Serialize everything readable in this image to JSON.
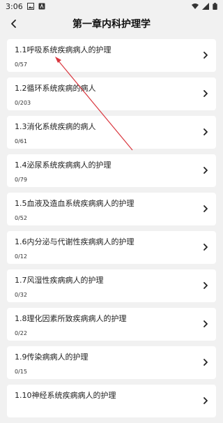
{
  "status": {
    "time": "3:06"
  },
  "header": {
    "title": "第一章内科护理学"
  },
  "chapters": [
    {
      "title": "1.1呼吸系统疾病病人的护理",
      "progress": "0/57"
    },
    {
      "title": "1.2循环系统疾病的病人",
      "progress": "0/203"
    },
    {
      "title": "1.3消化系统疾病的病人",
      "progress": "0/61"
    },
    {
      "title": "1.4泌尿系统疾病病人的护理",
      "progress": "0/79"
    },
    {
      "title": "1.5血液及造血系统疾病病人的护理",
      "progress": "0/52"
    },
    {
      "title": "1.6内分泌与代谢性疾病病人的护理",
      "progress": "0/12"
    },
    {
      "title": "1.7风湿性疾病病人的护理",
      "progress": "0/32"
    },
    {
      "title": "1.8理化因素所致疾病病人的护理",
      "progress": "0/22"
    },
    {
      "title": "1.9传染病病人的护理",
      "progress": "0/15"
    },
    {
      "title": "1.10神经系统疾病病人的护理",
      "progress": ""
    }
  ],
  "colors": {
    "background": "#f1f1f1",
    "card": "#ffffff",
    "annotation_arrow": "#d9363e"
  }
}
